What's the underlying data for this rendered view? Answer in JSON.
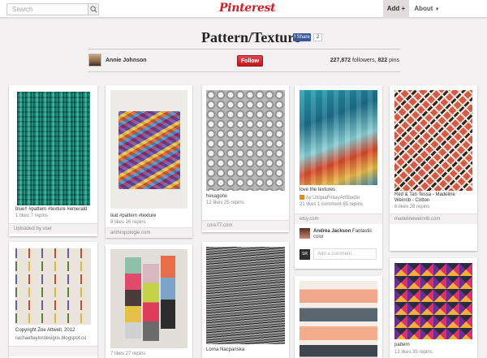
{
  "header": {
    "search_placeholder": "Search",
    "logo_text": "Pinterest",
    "add_label": "Add +",
    "about_label": "About"
  },
  "board": {
    "title": "Pattern/Texture",
    "share_label": "Share",
    "share_count": "2",
    "owner": "Annie Johnson",
    "follow_label": "Follow",
    "followers": "227,872",
    "followers_suffix": " followers, ",
    "pins": "822",
    "pins_suffix": " pins"
  },
  "pins": [
    {
      "desc": "blue!! #pattern #texture #emerald",
      "meta": "1 likes   7 repins",
      "source": "Uploaded by user"
    },
    {
      "desc": "ikat #pattern #texture",
      "meta": "8 likes   16 repins",
      "source": "anthropologie.com"
    },
    {
      "desc": "hexagons",
      "meta": "12 likes   25 repins",
      "source": "core77.com"
    },
    {
      "desc": "love the textures",
      "repin_by": "by UtopiaFinlayArtStudio",
      "meta": "21 likes   1 comment   65 repins",
      "source": "etsy.com",
      "comment_name": "Andrea Jackson",
      "comment_text_inline": " Fantastic",
      "comment_text": "color",
      "comment_input": "Add a comment...",
      "commenter_initials": "SR"
    },
    {
      "desc": "Red & Tan Tessa - Madeline Weinrib - Cotton",
      "meta": "6 likes   28 repins",
      "source": "madelineweinrib.com"
    },
    {
      "desc": "Copyright Zoe Attwell, 2012",
      "source": "rachaeltaylordesigns.blogspot.co"
    },
    {
      "meta": "7 likes   27 repins"
    },
    {
      "desc": "Lorna Nacpanska"
    },
    {
      "desc": "pattern",
      "meta": "13 likes   35 repins"
    }
  ],
  "colors": {
    "brand_red": "#cb2027",
    "background": "#f2f0f0",
    "facebook_blue": "#3b5998"
  }
}
